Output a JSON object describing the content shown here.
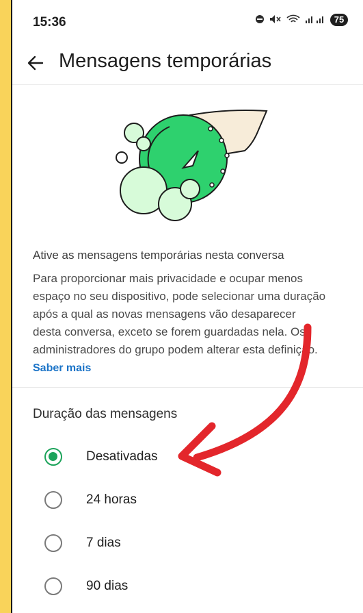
{
  "status_bar": {
    "time": "15:36",
    "battery": "75",
    "icons": [
      "do-not-disturb-icon",
      "mute-icon",
      "wifi-icon",
      "signal-icon"
    ]
  },
  "app_bar": {
    "title": "Mensagens temporárias"
  },
  "intro": {
    "title": "Ative as mensagens temporárias nesta conversa",
    "body_lines": [
      "Para proporcionar mais privacidade e ocupar menos",
      "espaço no seu dispositivo, pode selecionar uma duração",
      "após a qual as novas mensagens vão desaparecer",
      "desta conversa, exceto se forem guardadas nela. Os",
      "administradores do grupo podem alterar esta definição."
    ],
    "learn_more": "Saber mais"
  },
  "duration": {
    "title": "Duração das mensagens",
    "options": [
      {
        "label": "Desativadas",
        "selected": true
      },
      {
        "label": "24 horas",
        "selected": false
      },
      {
        "label": "7 dias",
        "selected": false
      },
      {
        "label": "90 dias",
        "selected": false
      }
    ]
  },
  "colors": {
    "accent_green": "#1ca35a",
    "link_blue": "#1a73c7",
    "annotation_red": "#e3262b",
    "frame_yellow": "#f9d35a"
  }
}
